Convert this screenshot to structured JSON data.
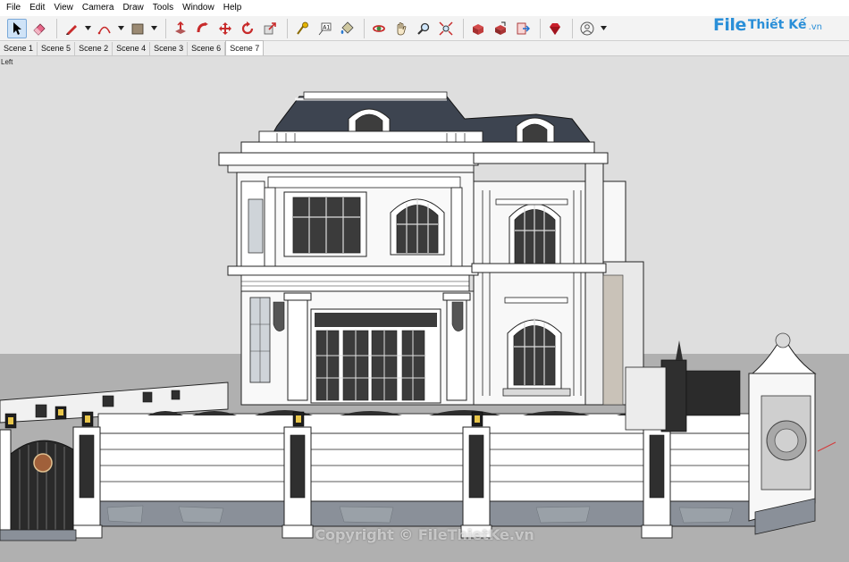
{
  "menu": [
    "File",
    "Edit",
    "View",
    "Camera",
    "Draw",
    "Tools",
    "Window",
    "Help"
  ],
  "toolbar": {
    "buttons": [
      {
        "name": "select-tool",
        "icon": "arrow-pointer-icon",
        "active": true
      },
      {
        "name": "eraser-tool",
        "icon": "eraser-icon"
      },
      {
        "name": "pencil-line-tool",
        "icon": "pencil-icon",
        "dropdown": true
      },
      {
        "name": "arc-tool",
        "icon": "arc-icon",
        "dropdown": true
      },
      {
        "name": "shape-tool",
        "icon": "rectangle-icon",
        "dropdown": true
      },
      {
        "name": "push-pull-tool",
        "icon": "push-pull-icon"
      },
      {
        "name": "follow-me-tool",
        "icon": "follow-me-icon"
      },
      {
        "name": "move-tool",
        "icon": "move-arrows-icon"
      },
      {
        "name": "rotate-tool",
        "icon": "rotate-icon"
      },
      {
        "name": "scale-tool",
        "icon": "scale-icon"
      },
      {
        "name": "tape-measure-tool",
        "icon": "tape-measure-icon"
      },
      {
        "name": "text-tool",
        "icon": "text-label-icon"
      },
      {
        "name": "paint-bucket-tool",
        "icon": "paint-bucket-icon"
      },
      {
        "name": "orbit-tool",
        "icon": "orbit-icon"
      },
      {
        "name": "pan-tool",
        "icon": "hand-icon"
      },
      {
        "name": "zoom-tool",
        "icon": "magnifier-icon"
      },
      {
        "name": "zoom-extents-tool",
        "icon": "zoom-extents-icon"
      },
      {
        "name": "warehouse-tool",
        "icon": "3d-warehouse-icon"
      },
      {
        "name": "share-model-tool",
        "icon": "share-model-icon"
      },
      {
        "name": "send-to-layout-tool",
        "icon": "send-to-layout-icon"
      },
      {
        "name": "extension-warehouse-tool",
        "icon": "ruby-gem-icon"
      },
      {
        "name": "account-button",
        "icon": "user-account-icon",
        "dropdown": true
      }
    ]
  },
  "logo": {
    "file": "File",
    "rest": "Thiết Kế",
    "tld": ".vn"
  },
  "scene_tabs": [
    "Scene 1",
    "Scene 5",
    "Scene 2",
    "Scene 4",
    "Scene 3",
    "Scene 6",
    "Scene 7"
  ],
  "active_scene": "Scene 7",
  "viewport": {
    "view_label": "Left",
    "watermark": "Copyright © FileThietKe.vn"
  },
  "colors": {
    "sky": "#dedede",
    "ground": "#b0b0b0",
    "roof": "#3d4450",
    "wall": "#ffffff",
    "stone": "#8a9099",
    "accent": "#2a8fd8"
  }
}
